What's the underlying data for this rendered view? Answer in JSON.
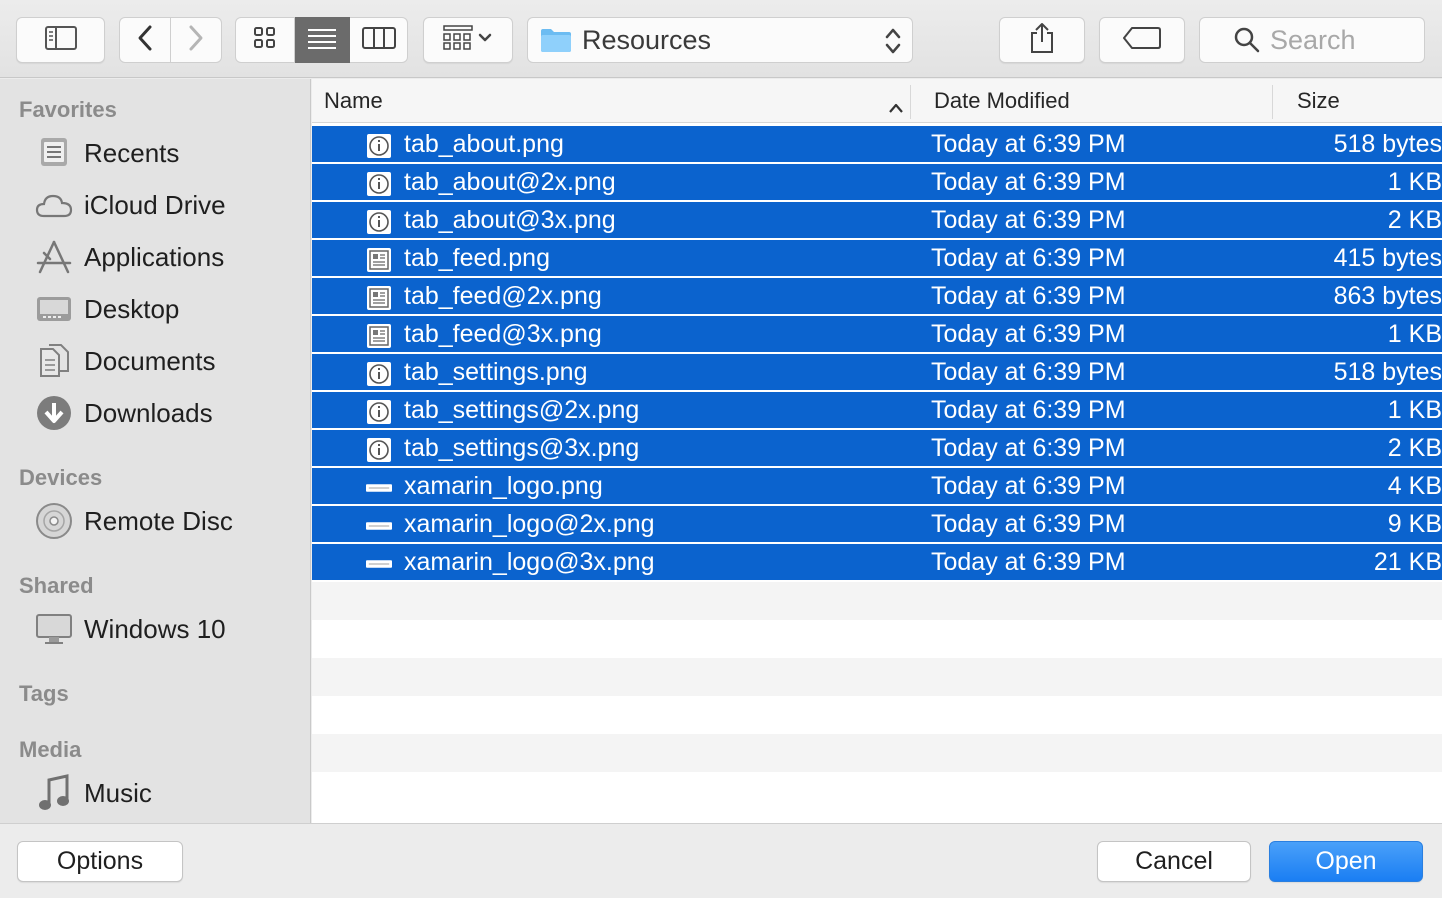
{
  "toolbar": {
    "sidebar_toggle_icon": "sidebar-icon",
    "back_icon": "chevron-left-icon",
    "forward_icon": "chevron-right-icon",
    "view_modes": [
      "icon-view",
      "list-view",
      "column-view"
    ],
    "active_view": "list-view",
    "arrange_icon": "arrange-grid-icon",
    "location": "Resources",
    "share_icon": "share-icon",
    "tag_icon": "tag-icon",
    "search_placeholder": "Search"
  },
  "sidebar": {
    "favorites_title": "Favorites",
    "favorites": [
      {
        "label": "Recents",
        "icon": "recents-icon"
      },
      {
        "label": "iCloud Drive",
        "icon": "cloud-icon"
      },
      {
        "label": "Applications",
        "icon": "applications-icon"
      },
      {
        "label": "Desktop",
        "icon": "desktop-icon"
      },
      {
        "label": "Documents",
        "icon": "documents-icon"
      },
      {
        "label": "Downloads",
        "icon": "downloads-icon"
      }
    ],
    "devices_title": "Devices",
    "devices": [
      {
        "label": "Remote Disc",
        "icon": "disc-icon"
      }
    ],
    "shared_title": "Shared",
    "shared": [
      {
        "label": "Windows 10",
        "icon": "display-icon"
      }
    ],
    "tags_title": "Tags",
    "media_title": "Media",
    "media": [
      {
        "label": "Music",
        "icon": "music-note-icon"
      }
    ]
  },
  "list": {
    "columns": {
      "name": "Name",
      "date": "Date Modified",
      "size": "Size"
    },
    "sort_indicator": "ascending",
    "files": [
      {
        "name": "tab_about.png",
        "date": "Today at 6:39 PM",
        "size": "518 bytes",
        "icon": "info-file-icon"
      },
      {
        "name": "tab_about@2x.png",
        "date": "Today at 6:39 PM",
        "size": "1 KB",
        "icon": "info-file-icon"
      },
      {
        "name": "tab_about@3x.png",
        "date": "Today at 6:39 PM",
        "size": "2 KB",
        "icon": "info-file-icon"
      },
      {
        "name": "tab_feed.png",
        "date": "Today at 6:39 PM",
        "size": "415 bytes",
        "icon": "feed-file-icon"
      },
      {
        "name": "tab_feed@2x.png",
        "date": "Today at 6:39 PM",
        "size": "863 bytes",
        "icon": "feed-file-icon"
      },
      {
        "name": "tab_feed@3x.png",
        "date": "Today at 6:39 PM",
        "size": "1 KB",
        "icon": "feed-file-icon"
      },
      {
        "name": "tab_settings.png",
        "date": "Today at 6:39 PM",
        "size": "518 bytes",
        "icon": "info-file-icon"
      },
      {
        "name": "tab_settings@2x.png",
        "date": "Today at 6:39 PM",
        "size": "1 KB",
        "icon": "info-file-icon"
      },
      {
        "name": "tab_settings@3x.png",
        "date": "Today at 6:39 PM",
        "size": "2 KB",
        "icon": "info-file-icon"
      },
      {
        "name": "xamarin_logo.png",
        "date": "Today at 6:39 PM",
        "size": "4 KB",
        "icon": "logo-file-icon"
      },
      {
        "name": "xamarin_logo@2x.png",
        "date": "Today at 6:39 PM",
        "size": "9 KB",
        "icon": "logo-file-icon"
      },
      {
        "name": "xamarin_logo@3x.png",
        "date": "Today at 6:39 PM",
        "size": "21 KB",
        "icon": "logo-file-icon"
      }
    ],
    "selection_color": "#0b63ce"
  },
  "footer": {
    "options_label": "Options",
    "cancel_label": "Cancel",
    "open_label": "Open",
    "accent": "#1a7ef3"
  }
}
